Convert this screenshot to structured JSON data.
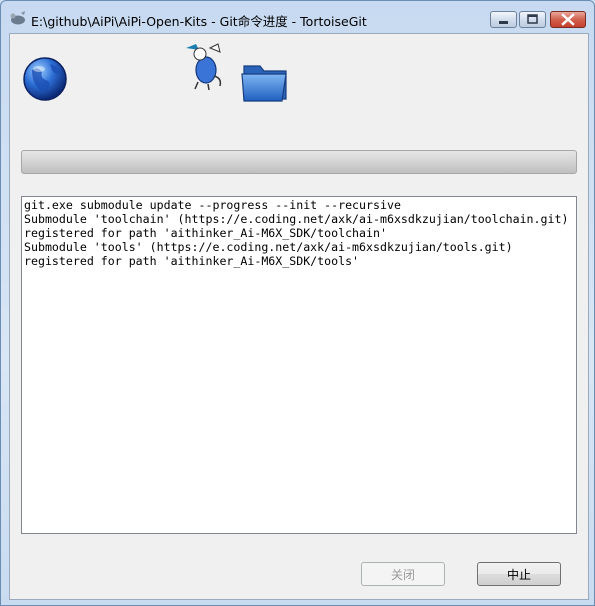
{
  "window": {
    "title": "E:\\github\\AiPi\\AiPi-Open-Kits - Git命令进度 - TortoiseGit"
  },
  "progress": {
    "fraction": 0
  },
  "log": {
    "lines": [
      "git.exe submodule update --progress --init --recursive",
      "Submodule 'toolchain' (https://e.coding.net/axk/ai-m6xsdkzujian/toolchain.git)",
      "registered for path 'aithinker_Ai-M6X_SDK/toolchain'",
      "Submodule 'tools' (https://e.coding.net/axk/ai-m6xsdkzujian/tools.git)",
      "registered for path 'aithinker_Ai-M6X_SDK/tools'"
    ]
  },
  "buttons": {
    "close_label": "关闭",
    "abort_label": "中止"
  },
  "icons": [
    "app-icon",
    "globe-icon",
    "tortoise-icon",
    "folder-icon",
    "minimize-icon",
    "maximize-icon",
    "close-icon"
  ]
}
